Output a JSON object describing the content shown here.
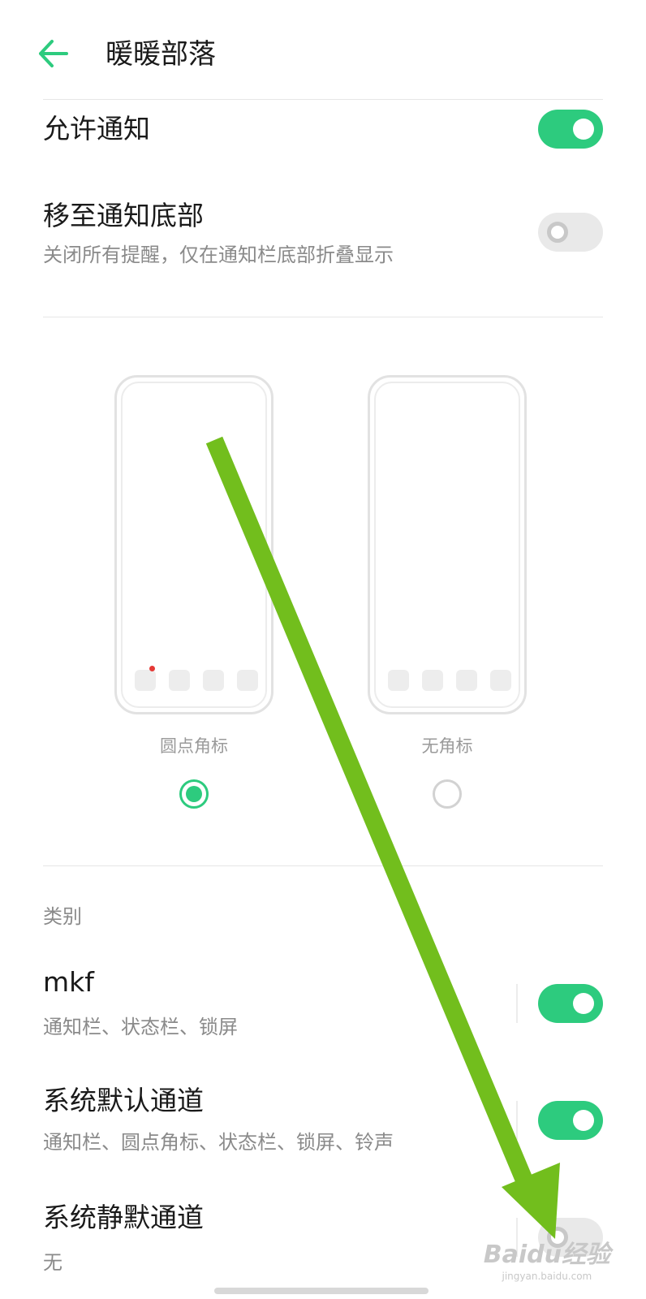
{
  "header": {
    "title": "暖暖部落",
    "back_icon": "arrow-left-icon",
    "back_color": "#2dcb7e"
  },
  "settings": {
    "allow_notifications": {
      "label": "允许通知",
      "enabled": true
    },
    "move_to_bottom": {
      "label": "移至通知底部",
      "description": "关闭所有提醒，仅在通知栏底部折叠显示",
      "enabled": false
    }
  },
  "badge_style": {
    "options": [
      {
        "label": "圆点角标",
        "selected": true
      },
      {
        "label": "无角标",
        "selected": false
      }
    ]
  },
  "categories": {
    "section_label": "类别",
    "items": [
      {
        "title": "mkf",
        "description": "通知栏、状态栏、锁屏",
        "enabled": true
      },
      {
        "title": "系统默认通道",
        "description": "通知栏、圆点角标、状态栏、锁屏、铃声",
        "enabled": true
      },
      {
        "title": "系统静默通道",
        "description": "无",
        "enabled": false
      }
    ]
  },
  "watermark": {
    "logo": "Baidu经验",
    "url": "jingyan.baidu.com"
  },
  "colors": {
    "accent": "#2dcb7e",
    "annotation_arrow": "#72be1d",
    "badge_dot": "#e53935"
  }
}
